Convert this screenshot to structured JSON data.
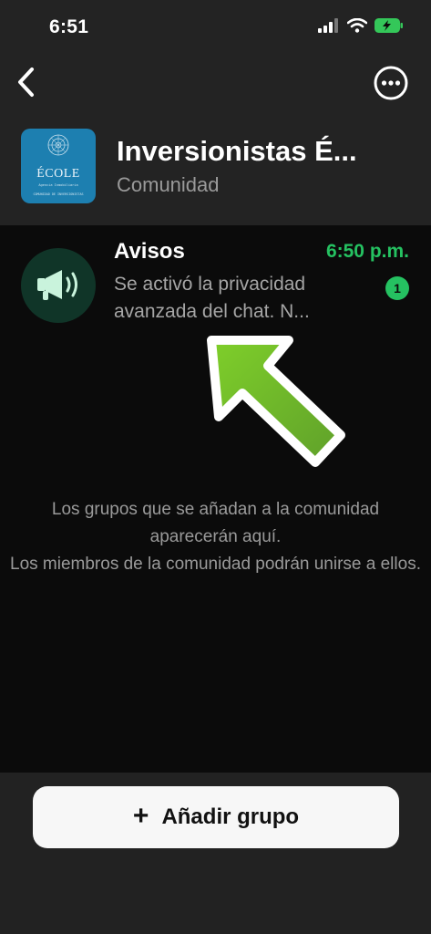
{
  "status_bar": {
    "time": "6:51"
  },
  "header": {
    "title": "Inversionistas É...",
    "subtitle": "Comunidad",
    "logo": {
      "main": "ÉCOLE",
      "tagline": "Agencia Inmobiliaria",
      "footer": "COMUNIDAD DE INVERSIONISTAS"
    }
  },
  "announcements": {
    "title": "Avisos",
    "time": "6:50 p.m.",
    "preview": "Se activó la privacidad avanzada del chat. N...",
    "unread_count": "1",
    "icon": "megaphone-icon"
  },
  "empty_state": {
    "line1": "Los grupos que se añadan a la comunidad aparecerán aquí.",
    "line2": "Los miembros de la comunidad podrán unirse a ellos."
  },
  "add_group": {
    "label": "Añadir grupo",
    "icon": "plus-icon"
  },
  "colors": {
    "accent": "#25c161",
    "background": "#232323",
    "list_background": "#0b0b0b",
    "arrow": "#6cbf2a"
  }
}
